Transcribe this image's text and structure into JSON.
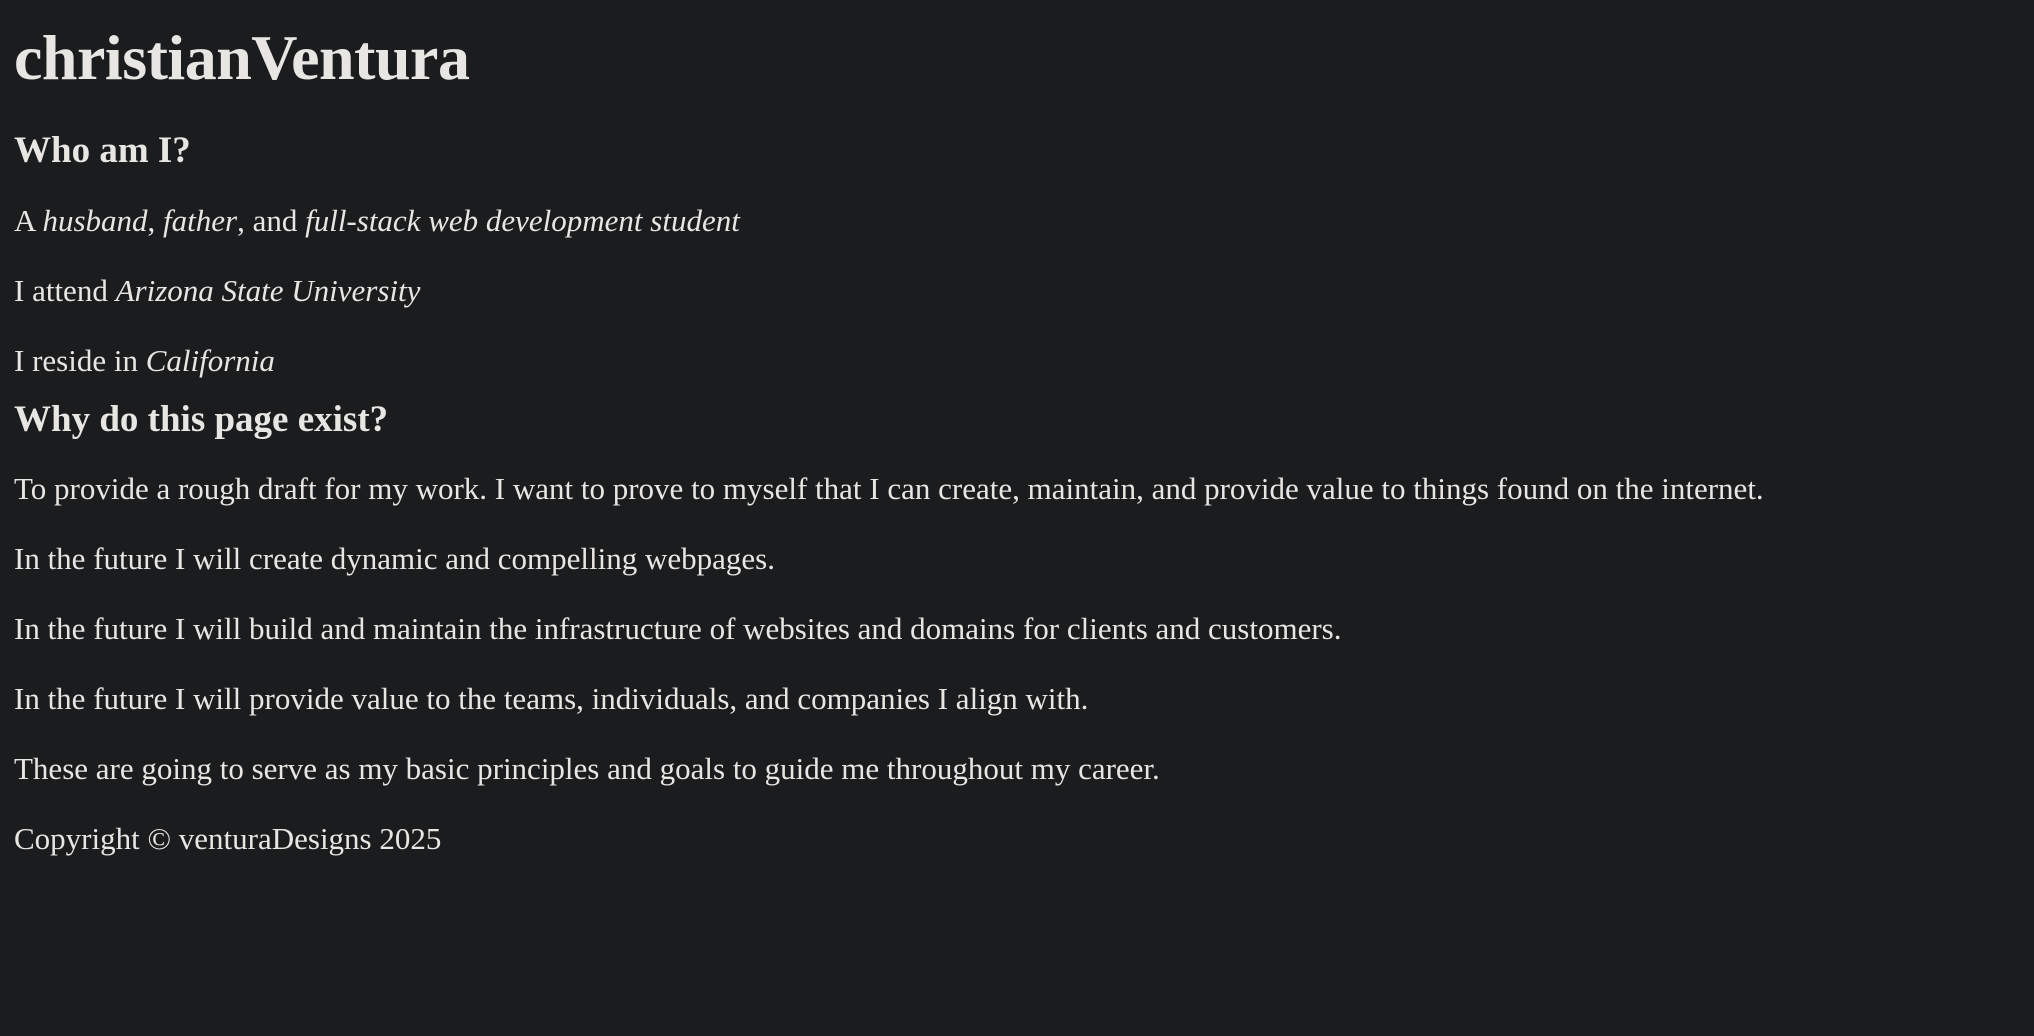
{
  "site_title": "christianVentura",
  "about": {
    "heading": "Who am I?",
    "line1": {
      "prefix": "A ",
      "husband": "husband",
      "sep1": ", ",
      "father": "father",
      "sep2": ", and ",
      "student": "full-stack web development student"
    },
    "line2": {
      "prefix": "I attend ",
      "school": "Arizona State University"
    },
    "line3": {
      "prefix": "I reside in ",
      "place": "California"
    }
  },
  "purpose": {
    "heading": "Why do this page exist?",
    "paragraphs": [
      "To provide a rough draft for my work. I want to prove to myself that I can create, maintain, and provide value to things found on the internet.",
      "In the future I will create dynamic and compelling webpages.",
      "In the future I will build and maintain the infrastructure of websites and domains for clients and customers.",
      "In the future I will provide value to the teams, individuals, and companies I align with.",
      "These are going to serve as my basic principles and goals to guide me throughout my career."
    ]
  },
  "footer": {
    "copyright": "Copyright © venturaDesigns 2025"
  }
}
